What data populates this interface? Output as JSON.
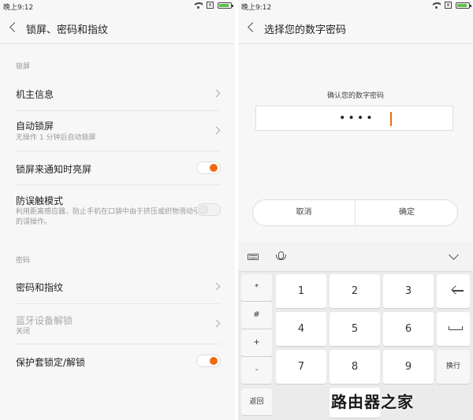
{
  "left": {
    "status": {
      "time": "晚上9:12",
      "sim": "x"
    },
    "title": "锁屏、密码和指纹",
    "section_lock": "锁屏",
    "owner_info": "机主信息",
    "auto_lock": {
      "title": "自动锁屏",
      "subtitle": "无操作 1 分钟后自动锁屏"
    },
    "wake_on_notify": {
      "title": "锁屏来通知时亮屏",
      "state": "on"
    },
    "anti_mistouch": {
      "title": "防误触模式",
      "subtitle": "利用距离感应器，防止手机在口袋中由于挤压或织物滑动引起的误操作。",
      "state": "off"
    },
    "section_password": "密码",
    "password_fingerprint": "密码和指纹",
    "bt_unlock": {
      "title": "蓝牙设备解锁",
      "subtitle": "关闭"
    },
    "case_lock": {
      "title": "保护套锁定/解锁",
      "state": "on"
    }
  },
  "right": {
    "status": {
      "time": "晚上9:12",
      "sim": "x"
    },
    "title": "选择您的数字密码",
    "confirm_label": "确认您的数字密码",
    "pin_masked": "••••",
    "cancel": "取消",
    "ok": "确定",
    "keyboard": {
      "symbols": [
        "*",
        "#",
        "+",
        "-"
      ],
      "return": "返回",
      "digits": [
        "1",
        "2",
        "3",
        "4",
        "5",
        "6",
        "7",
        "8",
        "9",
        "0"
      ],
      "newline": "换行"
    }
  },
  "watermark": "路由器之家",
  "colors": {
    "accent": "#f06a12",
    "battery": "#5cc24a"
  }
}
